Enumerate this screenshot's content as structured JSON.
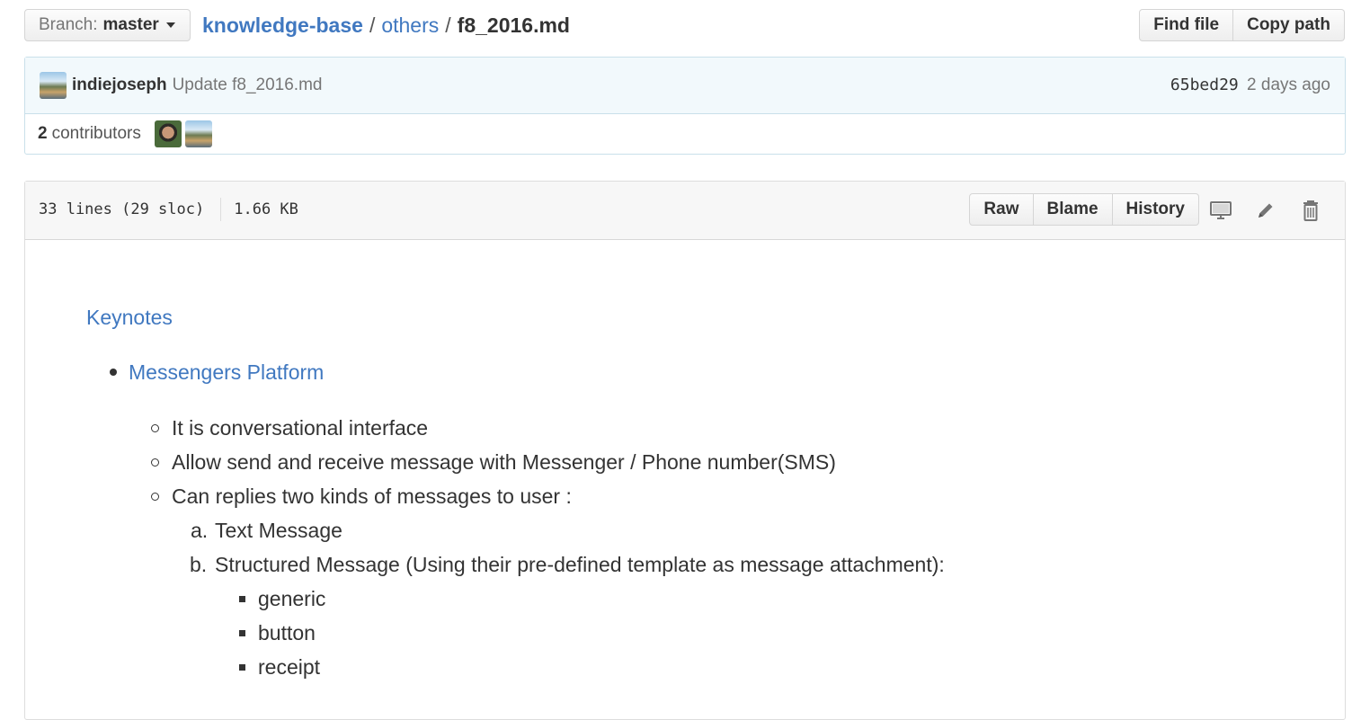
{
  "branch": {
    "label": "Branch:",
    "value": "master"
  },
  "breadcrumb": {
    "repo": "knowledge-base",
    "separator": "/",
    "dir": "others",
    "file": "f8_2016.md"
  },
  "top_actions": {
    "find_file": "Find file",
    "copy_path": "Copy path"
  },
  "commit": {
    "author": "indiejoseph",
    "message": "Update f8_2016.md",
    "sha": "65bed29",
    "ago": "2 days ago"
  },
  "contributors": {
    "count": "2",
    "label": "contributors"
  },
  "file": {
    "lines": "33 lines (29 sloc)",
    "size": "1.66 KB",
    "actions": {
      "raw": "Raw",
      "blame": "Blame",
      "history": "History"
    },
    "icons": [
      "desktop-icon",
      "pencil-icon",
      "trash-icon"
    ]
  },
  "markdown": {
    "heading_link": "Keynotes",
    "items": [
      {
        "text": "Messengers Platform",
        "level": 1,
        "bullet": "disc",
        "link": true
      },
      {
        "text": "It is conversational interface",
        "level": 2,
        "bullet": "circle"
      },
      {
        "text": "Allow send and receive message with Messenger / Phone number(SMS)",
        "level": 2,
        "bullet": "circle"
      },
      {
        "text": "Can replies two kinds of messages to user :",
        "level": 2,
        "bullet": "circle"
      },
      {
        "text": "Text Message",
        "level": 3,
        "bullet": "a."
      },
      {
        "text": "Structured Message (Using their pre-defined template as message attachment):",
        "level": 3,
        "bullet": "b."
      },
      {
        "text": "generic",
        "level": 4,
        "bullet": "square"
      },
      {
        "text": "button",
        "level": 4,
        "bullet": "square"
      },
      {
        "text": "receipt",
        "level": 4,
        "bullet": "square"
      }
    ]
  },
  "colors": {
    "link": "#4078c0",
    "text": "#333333",
    "muted": "#767676",
    "commit_bg": "#f2f9fc",
    "commit_border": "#c9e0ea"
  }
}
